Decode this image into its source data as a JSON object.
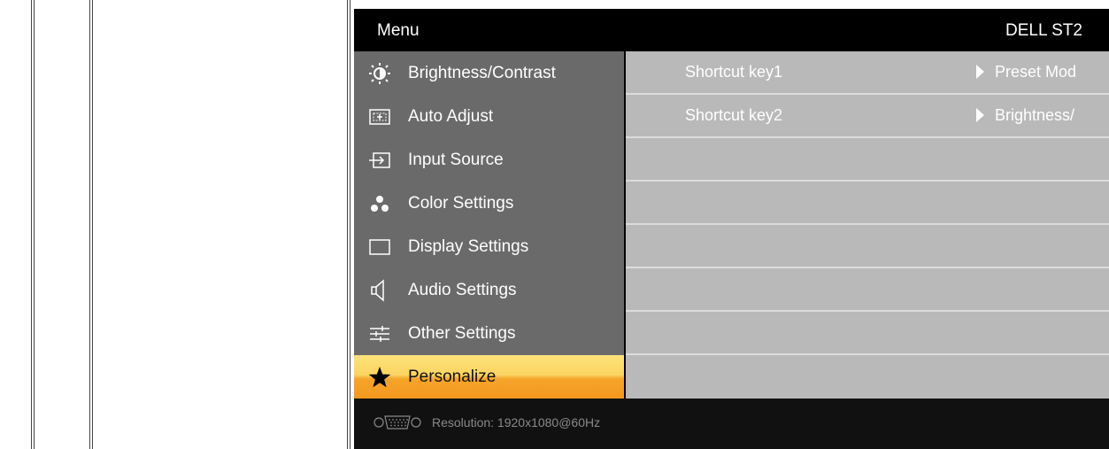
{
  "header": {
    "title": "Menu",
    "model": "DELL ST2"
  },
  "menu": [
    {
      "icon": "brightness-icon",
      "label": "Brightness/Contrast",
      "selected": false
    },
    {
      "icon": "auto-adjust-icon",
      "label": "Auto Adjust",
      "selected": false
    },
    {
      "icon": "input-source-icon",
      "label": "Input Source",
      "selected": false
    },
    {
      "icon": "color-settings-icon",
      "label": "Color Settings",
      "selected": false
    },
    {
      "icon": "display-settings-icon",
      "label": "Display Settings",
      "selected": false
    },
    {
      "icon": "audio-settings-icon",
      "label": "Audio Settings",
      "selected": false
    },
    {
      "icon": "other-settings-icon",
      "label": "Other Settings",
      "selected": false
    },
    {
      "icon": "star-icon",
      "label": "Personalize",
      "selected": true
    }
  ],
  "rows": [
    {
      "label": "Shortcut key1",
      "value": "Preset Mod"
    },
    {
      "label": "Shortcut key2",
      "value": "Brightness/"
    },
    {
      "label": "",
      "value": ""
    },
    {
      "label": "",
      "value": ""
    },
    {
      "label": "",
      "value": ""
    },
    {
      "label": "",
      "value": ""
    },
    {
      "label": "",
      "value": ""
    },
    {
      "label": "",
      "value": ""
    }
  ],
  "footer": {
    "connector_icon": "vga-connector-icon",
    "resolution": "Resolution:  1920x1080@60Hz"
  },
  "colors": {
    "left_panel": "#6a6a6a",
    "right_panel": "#b9b9b9",
    "selected_top": "#fde27a",
    "selected_bottom": "#f4981f",
    "background": "#000000"
  }
}
